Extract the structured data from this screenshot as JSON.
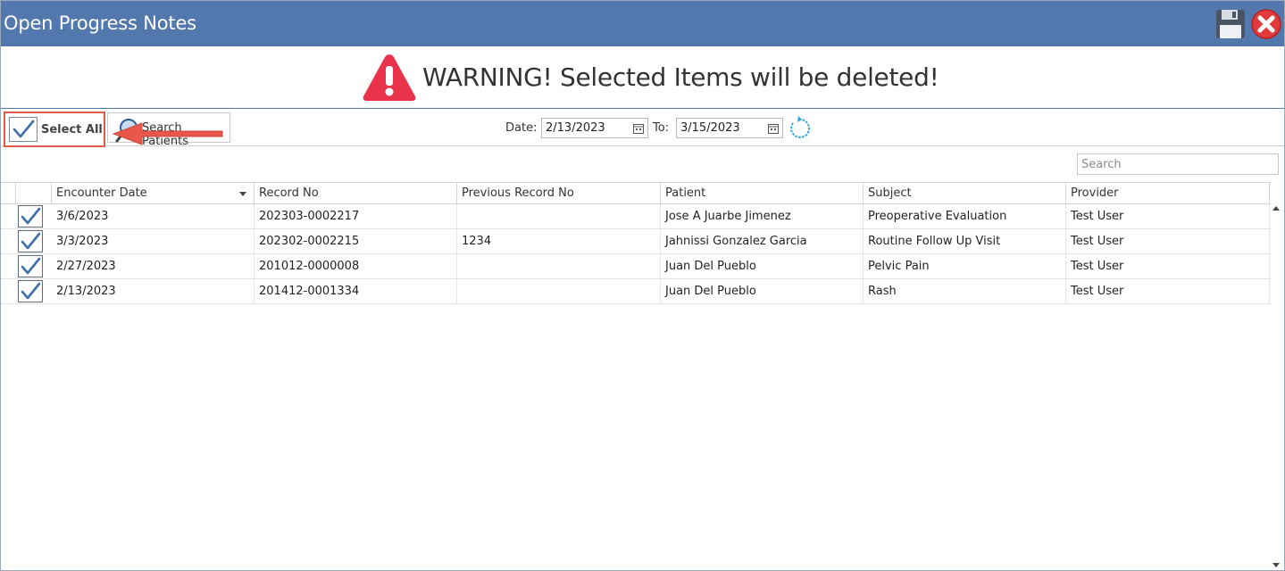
{
  "window": {
    "title": "Open Progress Notes",
    "save_icon": "floppy-disk-icon",
    "close_icon": "red-close-icon"
  },
  "warning": {
    "icon": "warning-triangle-icon",
    "text": "WARNING! Selected Items will be deleted!",
    "color": "#e8334a"
  },
  "toolbar": {
    "select_all_label": "Select All",
    "search_patients_label": "Search Patients",
    "date_label": "Date:",
    "date_from": "2/13/2023",
    "to_label": "To:",
    "date_to": "3/15/2023",
    "refresh_icon": "refresh-icon"
  },
  "grid": {
    "search_placeholder": "Search",
    "columns": [
      "Encounter Date",
      "Record No",
      "Previous Record No",
      "Patient",
      "Subject",
      "Provider"
    ],
    "sorted_column": "Encounter Date",
    "rows": [
      {
        "checked": true,
        "encounter_date": "3/6/2023",
        "record_no": "202303-0002217",
        "previous_record_no": "",
        "patient": "Jose A Juarbe Jimenez",
        "subject": "Preoperative Evaluation",
        "provider": "Test User"
      },
      {
        "checked": true,
        "encounter_date": "3/3/2023",
        "record_no": "202302-0002215",
        "previous_record_no": "1234",
        "patient": "Jahnissi Gonzalez Garcia",
        "subject": "Routine Follow Up Visit",
        "provider": "Test User"
      },
      {
        "checked": true,
        "encounter_date": "2/27/2023",
        "record_no": "201012-0000008",
        "previous_record_no": "",
        "patient": "Juan Del Pueblo",
        "subject": "Pelvic Pain",
        "provider": "Test User"
      },
      {
        "checked": true,
        "encounter_date": "2/13/2023",
        "record_no": "201412-0001334",
        "previous_record_no": "",
        "patient": "Juan Del Pueblo",
        "subject": "Rash",
        "provider": "Test User"
      }
    ]
  },
  "colors": {
    "titlebar": "#5278ad",
    "highlight_border": "#e05a4a",
    "arrow": "#e8584a",
    "check": "#3f6fa8"
  }
}
